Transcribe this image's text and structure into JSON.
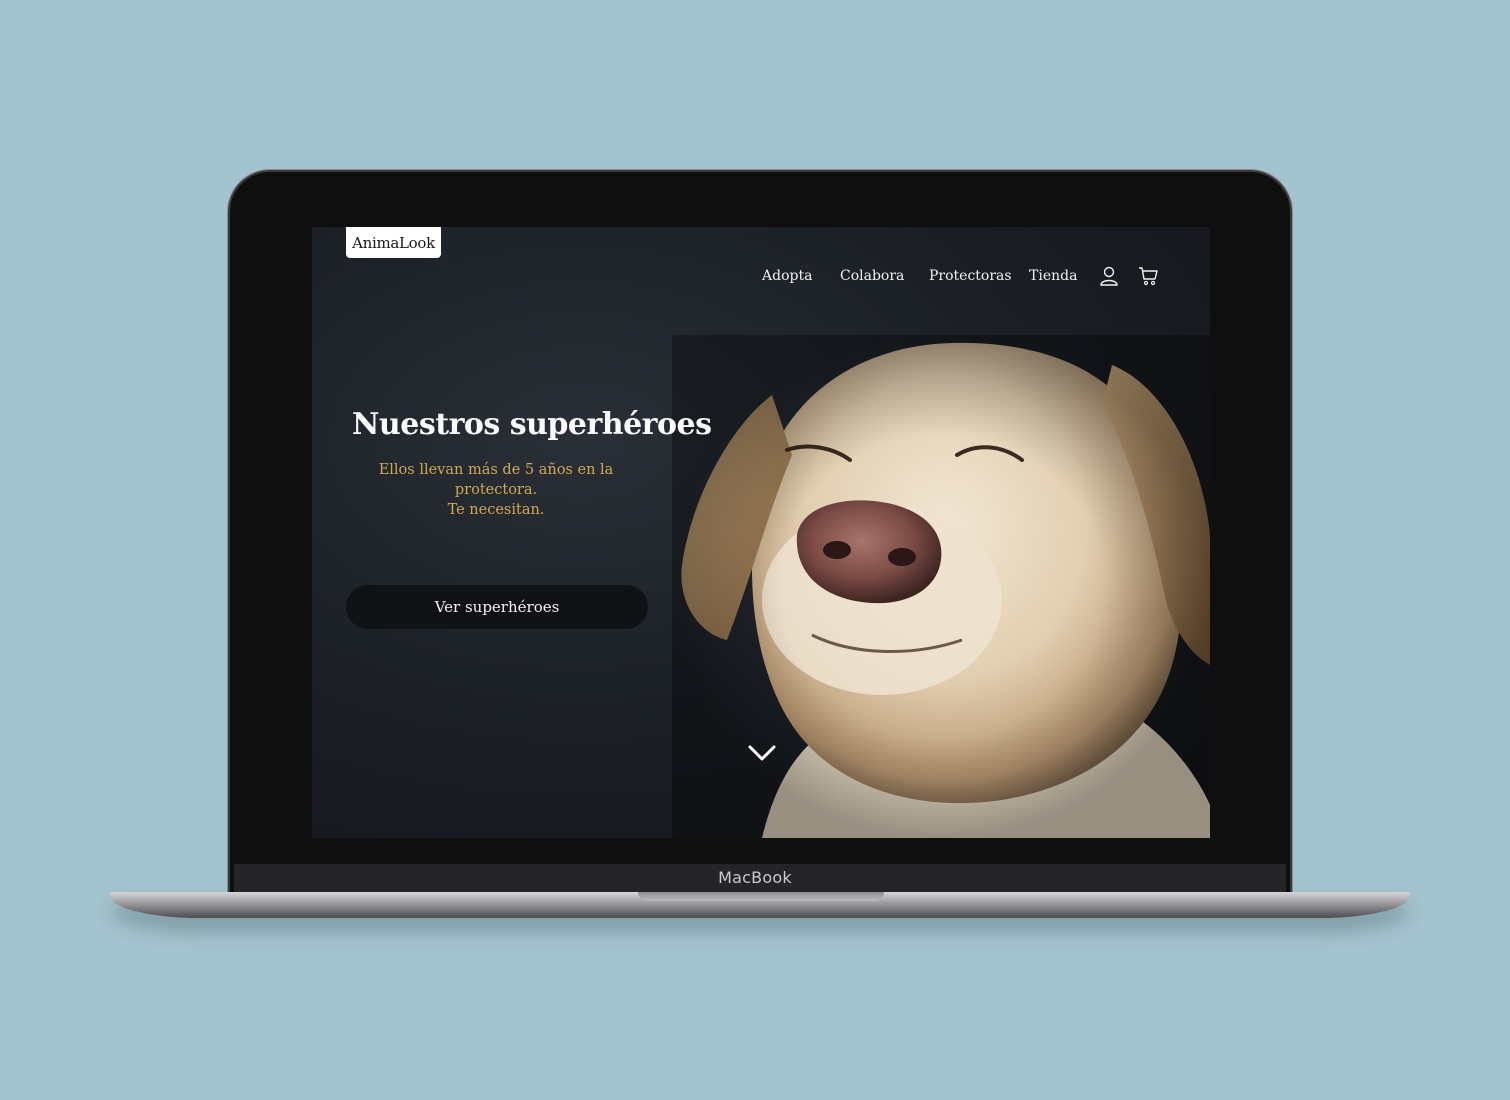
{
  "site": {
    "logo_text": "AnimaLook",
    "nav": {
      "items": [
        "Adopta",
        "Colabora",
        "Protectoras",
        "Tienda"
      ],
      "user_icon": "user-icon",
      "cart_icon": "cart-icon"
    },
    "hero": {
      "title": "Nuestros superhéroes",
      "subtitle_line1": "Ellos llevan más de 5 años en la protectora.",
      "subtitle_line2": "Te necesitan.",
      "cta_label": "Ver superhéroes",
      "scroll_icon": "chevron-down-icon",
      "image": "labrador-dog-photo"
    }
  },
  "device": {
    "label": "MacBook"
  },
  "colors": {
    "background": "#a3c3cf",
    "accent_gold": "#d1a94e",
    "screen_dark": "#1c2027",
    "button_bg": "#111215"
  }
}
